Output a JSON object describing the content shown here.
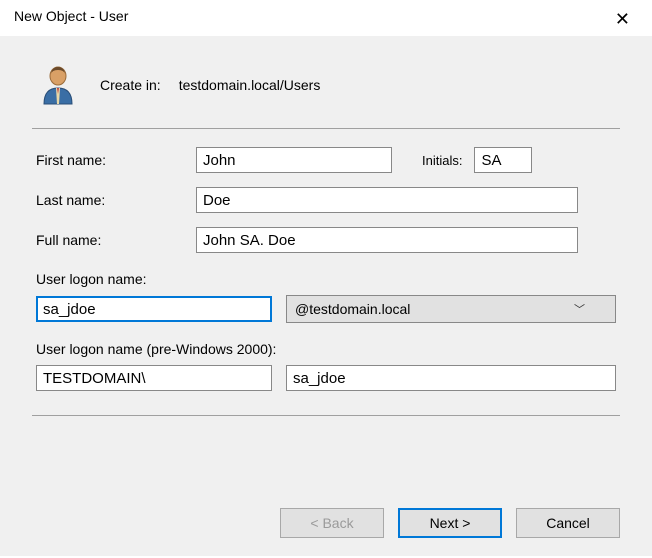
{
  "title": "New Object - User",
  "header": {
    "create_in_label": "Create in:",
    "create_in_path": "testdomain.local/Users"
  },
  "form": {
    "first_name_label": "First name:",
    "first_name_value": "John",
    "initials_label": "Initials:",
    "initials_value": "SA",
    "last_name_label": "Last name:",
    "last_name_value": "Doe",
    "full_name_label": "Full name:",
    "full_name_value": "John SA. Doe",
    "logon_label": "User logon name:",
    "logon_value": "sa_jdoe",
    "domain_suffix": "@testdomain.local",
    "pre2k_label": "User logon name (pre-Windows 2000):",
    "pre2k_domain": "TESTDOMAIN\\",
    "pre2k_user": "sa_jdoe"
  },
  "buttons": {
    "back": "< Back",
    "next": "Next >",
    "cancel": "Cancel"
  }
}
